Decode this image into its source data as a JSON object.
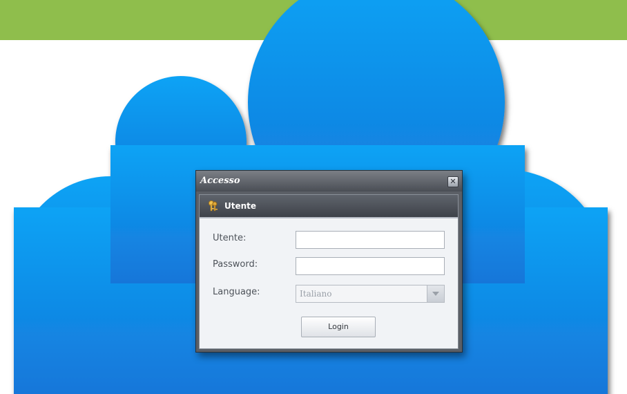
{
  "dialog": {
    "title": "Accesso",
    "close_symbol": "✕"
  },
  "panel": {
    "title": "Utente",
    "icon": "keys-icon"
  },
  "form": {
    "user_label": "Utente:",
    "user_value": "",
    "password_label": "Password:",
    "password_value": "",
    "language_label": "Language:",
    "language_value": "Italiano",
    "login_label": "Login"
  },
  "colors": {
    "top_band": "#8fbe4c",
    "cloud": "#1b8fe6"
  }
}
